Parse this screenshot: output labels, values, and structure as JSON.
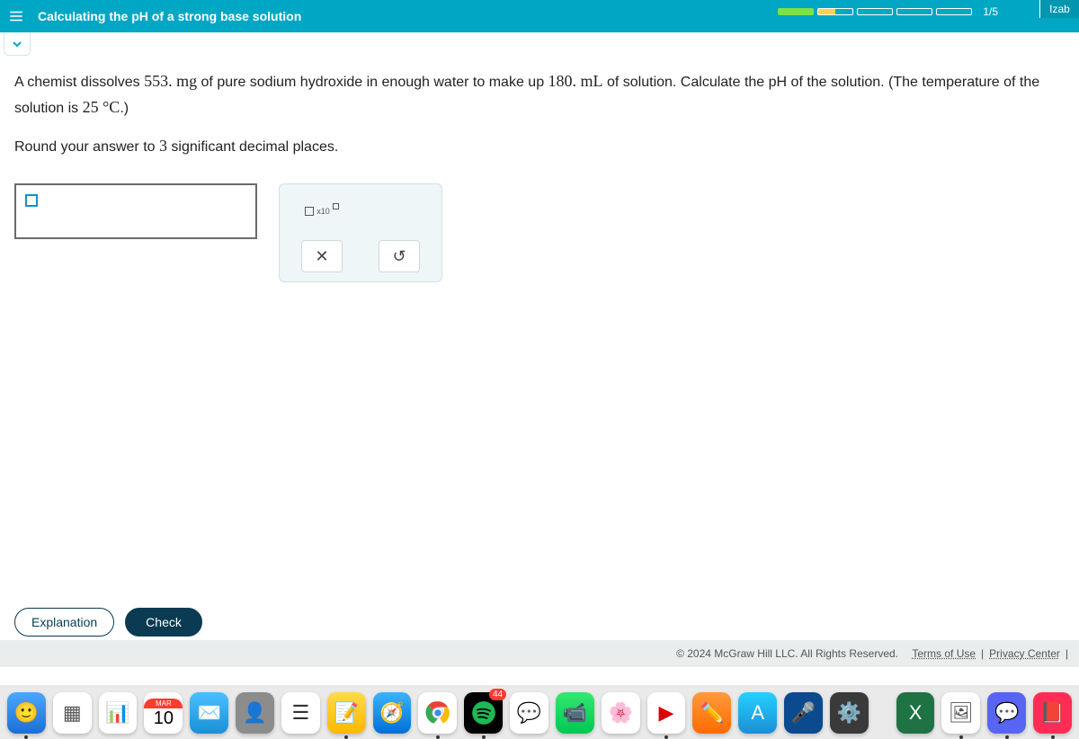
{
  "header": {
    "title": "Calculating the pH of a strong base solution",
    "counter": "1/5",
    "corner_label": "Izab"
  },
  "question": {
    "line1_a": "A chemist dissolves ",
    "val_mass": "553. mg",
    "line1_b": " of pure sodium hydroxide in enough water to make up ",
    "val_vol": "180. mL",
    "line1_c": " of solution. Calculate the pH of the solution. (The temperature of the solution is ",
    "val_temp": "25 °C",
    "line1_d": ".)",
    "line2_a": "Round your answer to ",
    "val_sig": "3",
    "line2_b": " significant decimal places."
  },
  "tools": {
    "sci_x10": "x10",
    "clear": "✕",
    "reset": "↺"
  },
  "actions": {
    "explanation": "Explanation",
    "check": "Check"
  },
  "legal": {
    "copyright": "© 2024 McGraw Hill LLC. All Rights Reserved.",
    "terms": "Terms of Use",
    "privacy": "Privacy Center",
    "sep": "|"
  },
  "dock": {
    "calendar_month": "MAR",
    "calendar_day": "10",
    "mail_badge": "44"
  }
}
